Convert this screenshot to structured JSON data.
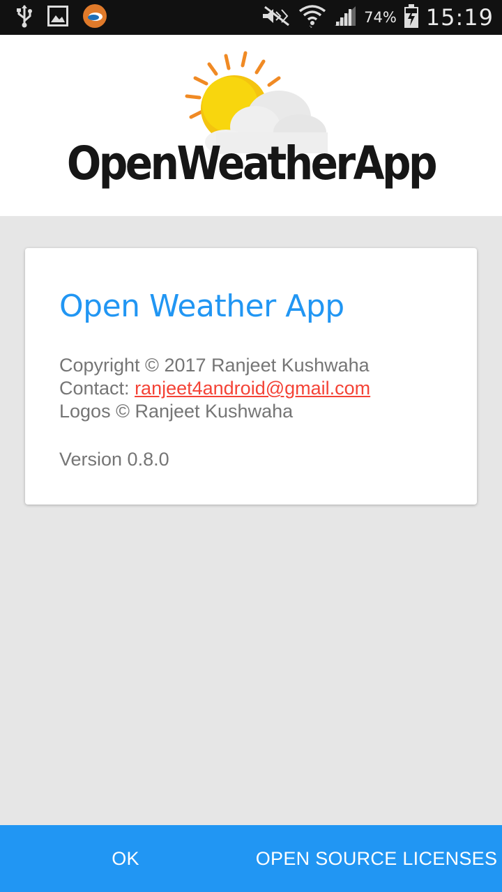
{
  "status_bar": {
    "icons": [
      "usb-icon",
      "gallery-icon",
      "weather-app-icon",
      "mute-icon",
      "wifi-icon",
      "signal-icon",
      "battery-charging-icon"
    ],
    "battery_percent": "74%",
    "time": "15:19"
  },
  "header": {
    "logo_text": "OpenWeatherApp"
  },
  "card": {
    "title": "Open Weather App",
    "copyright": "Copyright © 2017 Ranjeet Kushwaha",
    "contact_label": "Contact: ",
    "contact_email": "ranjeet4android@gmail.com",
    "logos": "Logos © Ranjeet Kushwaha",
    "version": "Version 0.8.0"
  },
  "buttons": {
    "ok": "OK",
    "licenses": "OPEN SOURCE LICENSES"
  },
  "colors": {
    "accent": "#2196f3",
    "link": "#f44336",
    "status_bar": "#111111",
    "background": "#e6e6e6"
  }
}
